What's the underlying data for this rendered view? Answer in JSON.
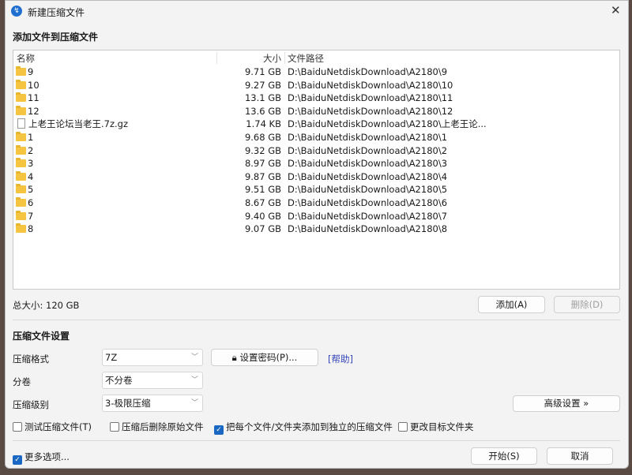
{
  "window": {
    "title": "新建压缩文件",
    "close": "✕"
  },
  "add_section": {
    "title": "添加文件到压缩文件",
    "columns": {
      "name": "名称",
      "size": "大小",
      "path": "文件路径"
    },
    "rows": [
      {
        "type": "folder",
        "name": "9",
        "size": "9.71 GB",
        "path": "D:\\BaiduNetdiskDownload\\A2180\\9"
      },
      {
        "type": "folder",
        "name": "10",
        "size": "9.27 GB",
        "path": "D:\\BaiduNetdiskDownload\\A2180\\10"
      },
      {
        "type": "folder",
        "name": "11",
        "size": "13.1 GB",
        "path": "D:\\BaiduNetdiskDownload\\A2180\\11"
      },
      {
        "type": "folder",
        "name": "12",
        "size": "13.6 GB",
        "path": "D:\\BaiduNetdiskDownload\\A2180\\12"
      },
      {
        "type": "file",
        "name": "上老王论坛当老王.7z.gz",
        "size": "1.74 KB",
        "path": "D:\\BaiduNetdiskDownload\\A2180\\上老王论..."
      },
      {
        "type": "folder",
        "name": "1",
        "size": "9.68 GB",
        "path": "D:\\BaiduNetdiskDownload\\A2180\\1"
      },
      {
        "type": "folder",
        "name": "2",
        "size": "9.32 GB",
        "path": "D:\\BaiduNetdiskDownload\\A2180\\2"
      },
      {
        "type": "folder",
        "name": "3",
        "size": "8.97 GB",
        "path": "D:\\BaiduNetdiskDownload\\A2180\\3"
      },
      {
        "type": "folder",
        "name": "4",
        "size": "9.87 GB",
        "path": "D:\\BaiduNetdiskDownload\\A2180\\4"
      },
      {
        "type": "folder",
        "name": "5",
        "size": "9.51 GB",
        "path": "D:\\BaiduNetdiskDownload\\A2180\\5"
      },
      {
        "type": "folder",
        "name": "6",
        "size": "8.67 GB",
        "path": "D:\\BaiduNetdiskDownload\\A2180\\6"
      },
      {
        "type": "folder",
        "name": "7",
        "size": "9.40 GB",
        "path": "D:\\BaiduNetdiskDownload\\A2180\\7"
      },
      {
        "type": "folder",
        "name": "8",
        "size": "9.07 GB",
        "path": "D:\\BaiduNetdiskDownload\\A2180\\8"
      }
    ],
    "total": "总大小: 120 GB",
    "add_btn": "添加(A)",
    "delete_btn": "删除(D)"
  },
  "settings": {
    "title": "压缩文件设置",
    "format_label": "压缩格式",
    "format_value": "7Z",
    "password_btn": "设置密码(P)...",
    "help_link": "[帮助]",
    "split_label": "分卷",
    "split_value": "不分卷",
    "level_label": "压缩级别",
    "level_value": "3-极限压缩",
    "advanced_btn": "高级设置 »",
    "checkboxes": [
      {
        "label": "测试压缩文件(T)",
        "checked": false
      },
      {
        "label": "压缩后删除原始文件",
        "checked": false
      },
      {
        "label": "把每个文件/文件夹添加到独立的压缩文件",
        "checked": true
      },
      {
        "label": "更改目标文件夹",
        "checked": false
      }
    ]
  },
  "footer": {
    "more_options": "更多选项...",
    "more_checked": true,
    "start_btn": "开始(S)",
    "cancel_btn": "取消"
  }
}
